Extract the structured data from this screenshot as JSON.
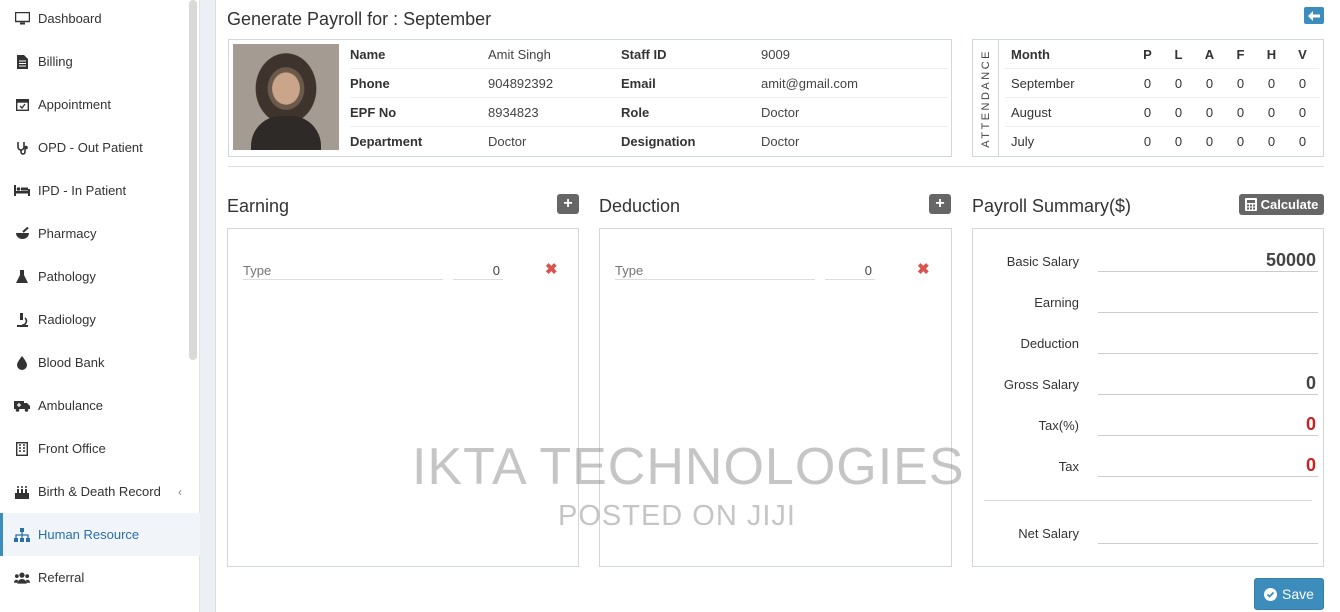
{
  "sidebar": {
    "items": [
      {
        "label": "Dashboard",
        "icon": "monitor-icon"
      },
      {
        "label": "Billing",
        "icon": "file-icon"
      },
      {
        "label": "Appointment",
        "icon": "calendar-icon"
      },
      {
        "label": "OPD - Out Patient",
        "icon": "stethoscope-icon"
      },
      {
        "label": "IPD - In Patient",
        "icon": "bed-icon"
      },
      {
        "label": "Pharmacy",
        "icon": "mortar-pestle-icon"
      },
      {
        "label": "Pathology",
        "icon": "flask-icon"
      },
      {
        "label": "Radiology",
        "icon": "microscope-icon"
      },
      {
        "label": "Blood Bank",
        "icon": "tint-icon"
      },
      {
        "label": "Ambulance",
        "icon": "ambulance-icon"
      },
      {
        "label": "Front Office",
        "icon": "building-icon"
      },
      {
        "label": "Birth & Death Record",
        "icon": "birthday-cake-icon"
      },
      {
        "label": "Human Resource",
        "icon": "sitemap-icon"
      },
      {
        "label": "Referral",
        "icon": "users-icon"
      }
    ],
    "active": "Human Resource"
  },
  "page": {
    "title": "Generate Payroll for : September"
  },
  "staff": {
    "name_label": "Name",
    "name": "Amit Singh",
    "staff_id_label": "Staff ID",
    "staff_id": "9009",
    "phone_label": "Phone",
    "phone": "904892392",
    "email_label": "Email",
    "email": "amit@gmail.com",
    "epf_label": "EPF No",
    "epf": "8934823",
    "role_label": "Role",
    "role": "Doctor",
    "department_label": "Department",
    "department": "Doctor",
    "designation_label": "Designation",
    "designation": "Doctor"
  },
  "attendance": {
    "vertical_label": "ATTENDANCE",
    "headers": [
      "Month",
      "P",
      "L",
      "A",
      "F",
      "H",
      "V"
    ],
    "rows": [
      {
        "month": "September",
        "values": [
          "0",
          "0",
          "0",
          "0",
          "0",
          "0"
        ]
      },
      {
        "month": "August",
        "values": [
          "0",
          "0",
          "0",
          "0",
          "0",
          "0"
        ]
      },
      {
        "month": "July",
        "values": [
          "0",
          "0",
          "0",
          "0",
          "0",
          "0"
        ]
      }
    ]
  },
  "earning": {
    "title": "Earning",
    "type_placeholder": "Type",
    "amount": "0"
  },
  "deduction": {
    "title": "Deduction",
    "type_placeholder": "Type",
    "amount": "0"
  },
  "summary": {
    "title": "Payroll Summary($)",
    "calculate_label": "Calculate",
    "basic_salary_label": "Basic Salary",
    "basic_salary": "50000",
    "earning_label": "Earning",
    "earning": "",
    "deduction_label": "Deduction",
    "deduction": "",
    "gross_salary_label": "Gross Salary",
    "gross_salary": "0",
    "tax_percent_label": "Tax(%)",
    "tax_percent": "0",
    "tax_label": "Tax",
    "tax": "0",
    "net_salary_label": "Net Salary",
    "net_salary": ""
  },
  "save_label": "Save",
  "watermark": {
    "line1": "IKTA TECHNOLOGIES",
    "line2": "POSTED ON JIJI"
  },
  "colors": {
    "accent": "#3c8dbc",
    "danger": "#d9534f",
    "dark_button": "#666666"
  }
}
